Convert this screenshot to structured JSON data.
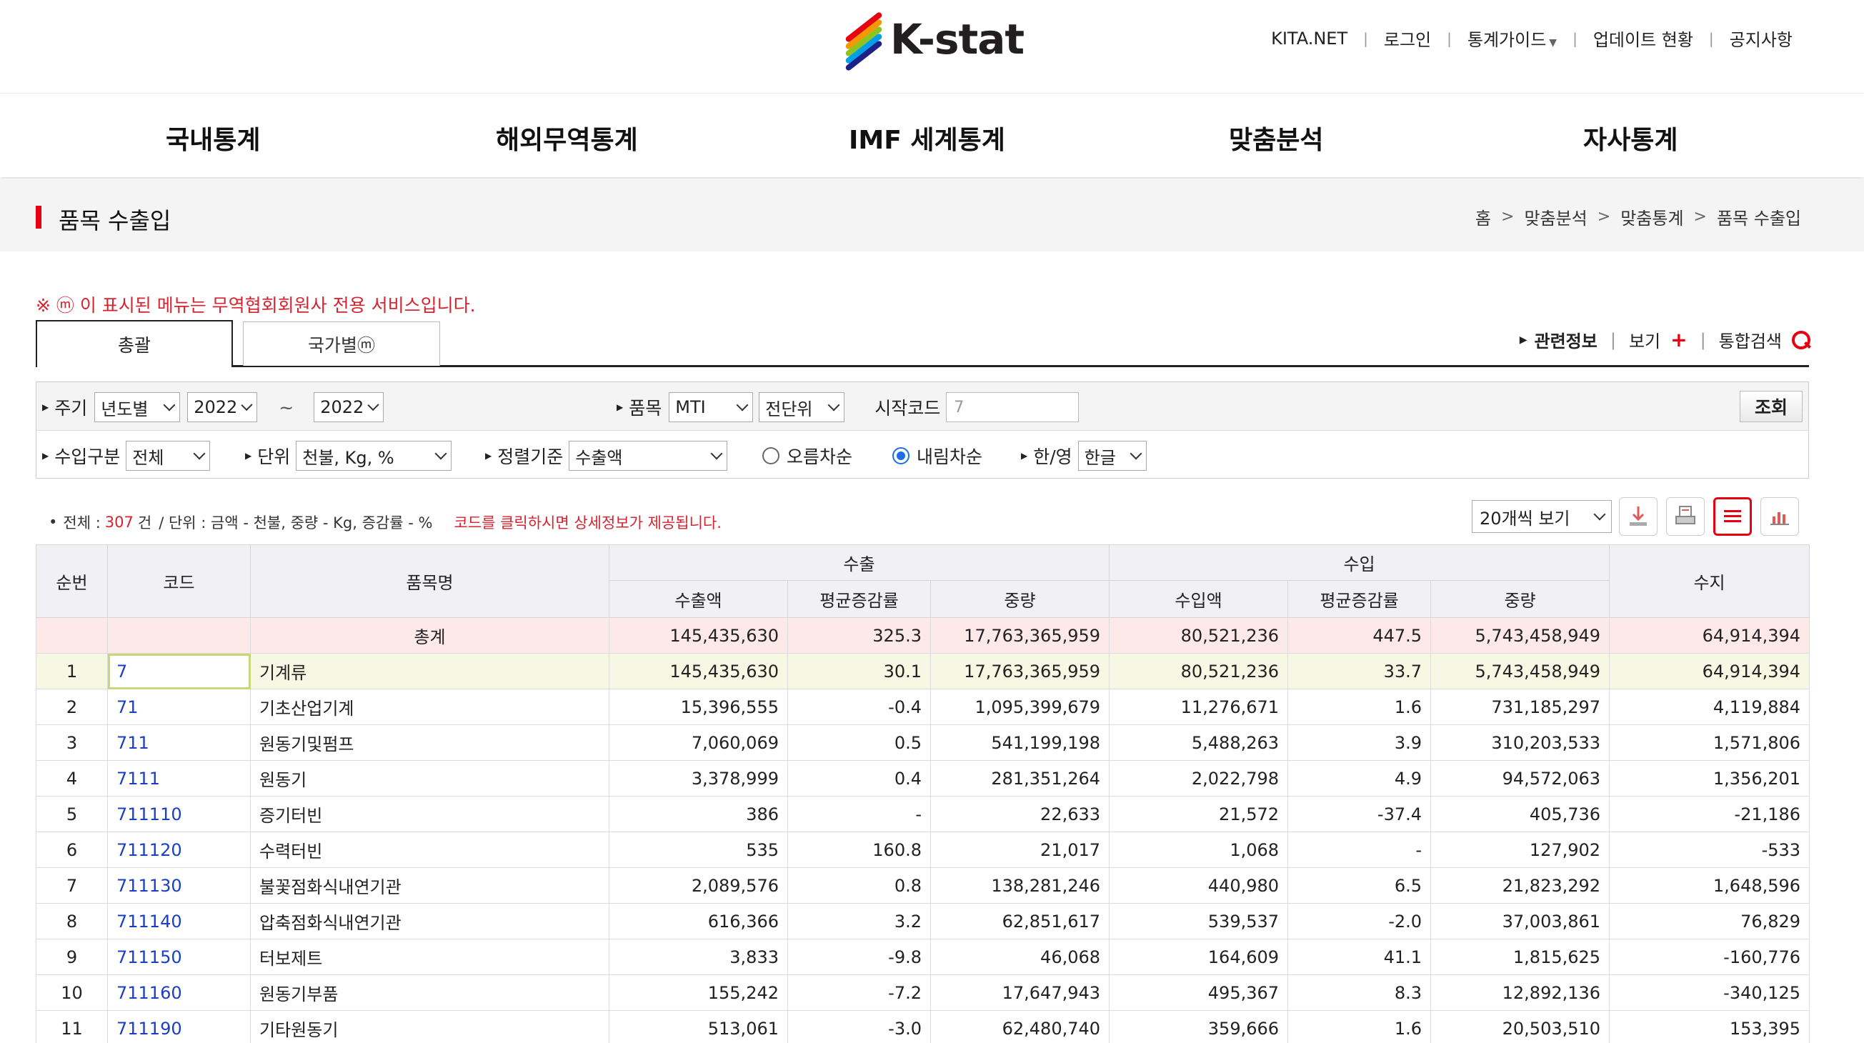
{
  "header": {
    "logo_text": "K-stat",
    "links": [
      "KITA.NET",
      "로그인",
      "통계가이드",
      "업데이트 현황",
      "공지사항"
    ]
  },
  "nav": [
    "국내통계",
    "해외무역통계",
    "IMF 세계통계",
    "맞춤분석",
    "자사통계"
  ],
  "page": {
    "title": "품목 수출입",
    "breadcrumb": [
      "홈",
      "맞춤분석",
      "맞춤통계",
      "품목 수출입"
    ],
    "notice": "※ ⓜ 이 표시된 메뉴는 무역협회회원사 전용 서비스입니다."
  },
  "tabs": [
    "총괄",
    "국가별ⓜ"
  ],
  "right_links": {
    "related": "관련정보",
    "view": "보기",
    "search": "통합검색"
  },
  "filters": {
    "period_label": "주기",
    "period_type": "년도별",
    "year_from": "2022",
    "tilde": "~",
    "year_to": "2022",
    "item_label": "품목",
    "item_class": "MTI",
    "item_unit": "전단위",
    "start_code_label": "시작코드",
    "start_code_placeholder": "7",
    "search_button": "조회",
    "import_type_label": "수입구분",
    "import_type": "전체",
    "unit_label": "단위",
    "unit": "천불, Kg, %",
    "sort_label": "정렬기준",
    "sort_by": "수출액",
    "asc_label": "오름차순",
    "desc_label": "내림차순",
    "order_selected": "desc",
    "lang_label": "한/영",
    "lang": "한글"
  },
  "summary": {
    "total_label": "전체 :",
    "count": "307",
    "count_unit": "건",
    "unit_text": "/ 단위 : 금액 - 천불, 중량 - Kg, 증감률 - %",
    "hint": "코드를 클릭하시면 상세정보가 제공됩니다.",
    "page_size": "20개씩 보기"
  },
  "table": {
    "headers": {
      "rank": "순번",
      "code": "코드",
      "name": "품목명",
      "export": "수출",
      "import": "수입",
      "balance": "수지",
      "exp_amount": "수출액",
      "exp_rate": "평균증감률",
      "exp_weight": "중량",
      "imp_amount": "수입액",
      "imp_rate": "평균증감률",
      "imp_weight": "중량"
    },
    "total": {
      "label": "총계",
      "values": [
        "145,435,630",
        "325.3",
        "17,763,365,959",
        "80,521,236",
        "447.5",
        "5,743,458,949",
        "64,914,394"
      ]
    },
    "rows": [
      [
        "1",
        "7",
        "기계류",
        "145,435,630",
        "30.1",
        "17,763,365,959",
        "80,521,236",
        "33.7",
        "5,743,458,949",
        "64,914,394"
      ],
      [
        "2",
        "71",
        "기초산업기계",
        "15,396,555",
        "-0.4",
        "1,095,399,679",
        "11,276,671",
        "1.6",
        "731,185,297",
        "4,119,884"
      ],
      [
        "3",
        "711",
        "원동기및펌프",
        "7,060,069",
        "0.5",
        "541,199,198",
        "5,488,263",
        "3.9",
        "310,203,533",
        "1,571,806"
      ],
      [
        "4",
        "7111",
        "원동기",
        "3,378,999",
        "0.4",
        "281,351,264",
        "2,022,798",
        "4.9",
        "94,572,063",
        "1,356,201"
      ],
      [
        "5",
        "711110",
        "증기터빈",
        "386",
        "-",
        "22,633",
        "21,572",
        "-37.4",
        "405,736",
        "-21,186"
      ],
      [
        "6",
        "711120",
        "수력터빈",
        "535",
        "160.8",
        "21,017",
        "1,068",
        "-",
        "127,902",
        "-533"
      ],
      [
        "7",
        "711130",
        "불꽃점화식내연기관",
        "2,089,576",
        "0.8",
        "138,281,246",
        "440,980",
        "6.5",
        "21,823,292",
        "1,648,596"
      ],
      [
        "8",
        "711140",
        "압축점화식내연기관",
        "616,366",
        "3.2",
        "62,851,617",
        "539,537",
        "-2.0",
        "37,003,861",
        "76,829"
      ],
      [
        "9",
        "711150",
        "터보제트",
        "3,833",
        "-9.8",
        "46,068",
        "164,609",
        "41.1",
        "1,815,625",
        "-160,776"
      ],
      [
        "10",
        "711160",
        "원동기부품",
        "155,242",
        "-7.2",
        "17,647,943",
        "495,367",
        "8.3",
        "12,892,136",
        "-340,125"
      ],
      [
        "11",
        "711190",
        "기타원동기",
        "513,061",
        "-3.0",
        "62,480,740",
        "359,666",
        "1.6",
        "20,503,510",
        "153,395"
      ]
    ]
  },
  "colors": {
    "accent": "#e60012",
    "code_link": "#1a3fc4",
    "total_row": "#fde8ea",
    "highlight_row": "#f6f8e4"
  }
}
